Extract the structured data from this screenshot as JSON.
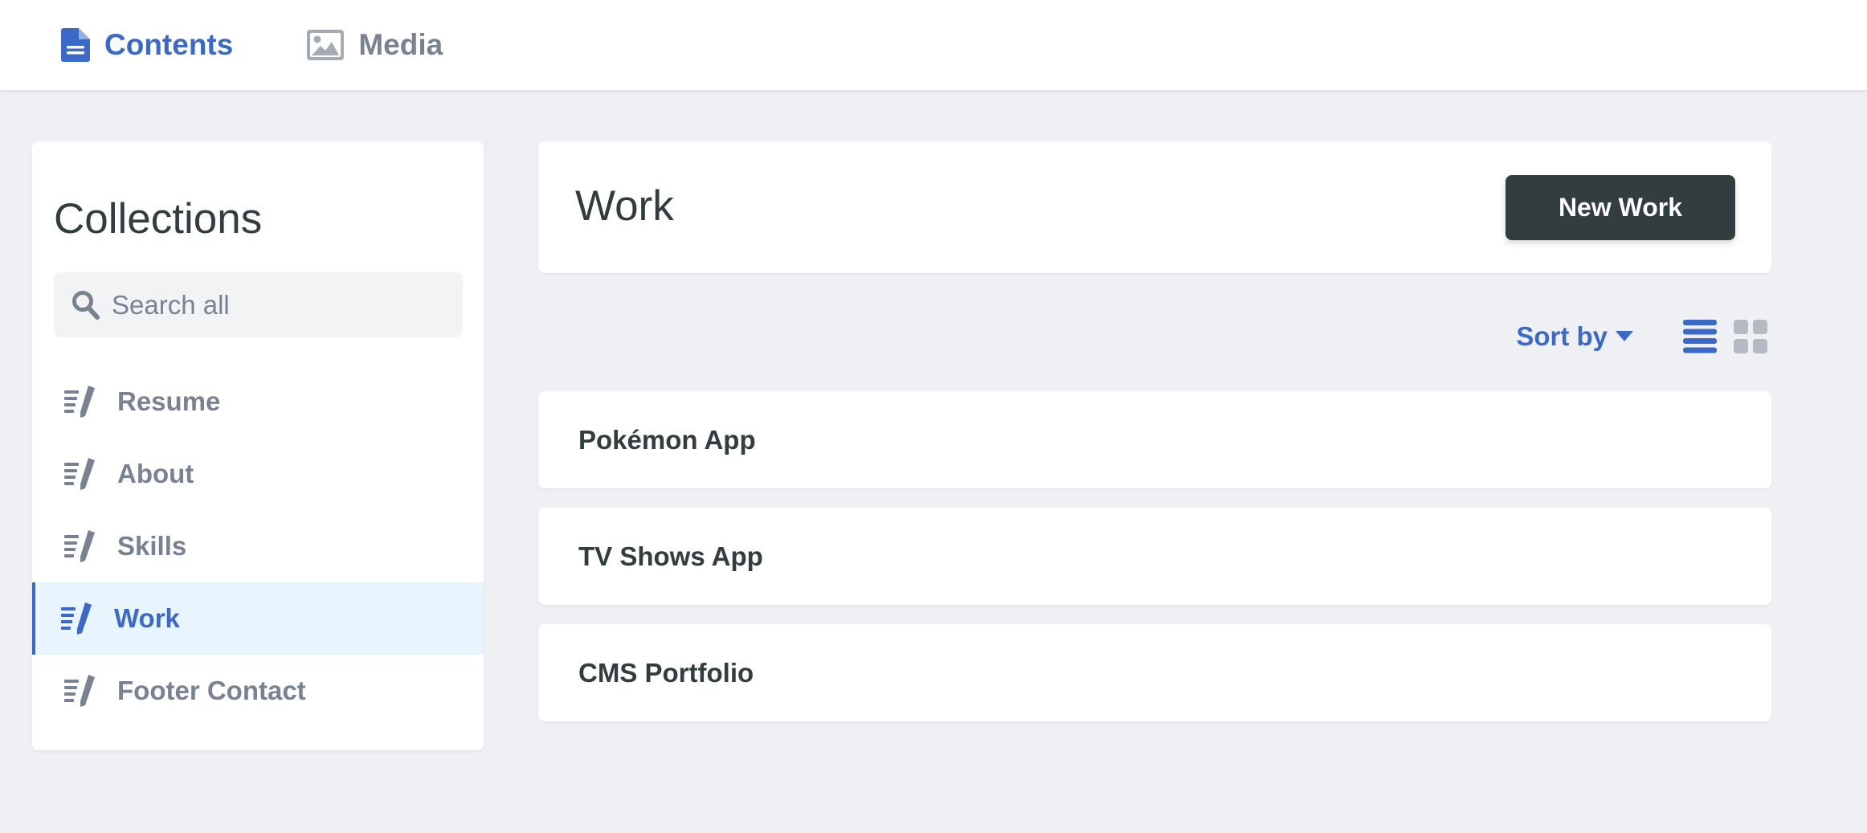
{
  "colors": {
    "accent": "#3a69c7",
    "muted": "#798291",
    "text": "#313d3e",
    "background": "#eff0f4",
    "active_item_bg": "#e8f5fe",
    "button_bg": "#313d3e"
  },
  "topnav": {
    "tabs": [
      {
        "label": "Contents",
        "icon": "document-icon",
        "active": true
      },
      {
        "label": "Media",
        "icon": "image-icon",
        "active": false
      }
    ]
  },
  "sidebar": {
    "title": "Collections",
    "search": {
      "placeholder": "Search all",
      "value": ""
    },
    "items": [
      {
        "label": "Resume",
        "icon": "edit-entries-icon",
        "active": false
      },
      {
        "label": "About",
        "icon": "edit-entries-icon",
        "active": false
      },
      {
        "label": "Skills",
        "icon": "edit-entries-icon",
        "active": false
      },
      {
        "label": "Work",
        "icon": "edit-entries-icon",
        "active": true
      },
      {
        "label": "Footer Contact",
        "icon": "edit-entries-icon",
        "active": false
      }
    ]
  },
  "main": {
    "title": "Work",
    "new_button_label": "New Work",
    "sort_label": "Sort by",
    "view_mode": "list",
    "entries": [
      {
        "title": "Pokémon App"
      },
      {
        "title": "TV Shows App"
      },
      {
        "title": "CMS Portfolio"
      }
    ]
  }
}
